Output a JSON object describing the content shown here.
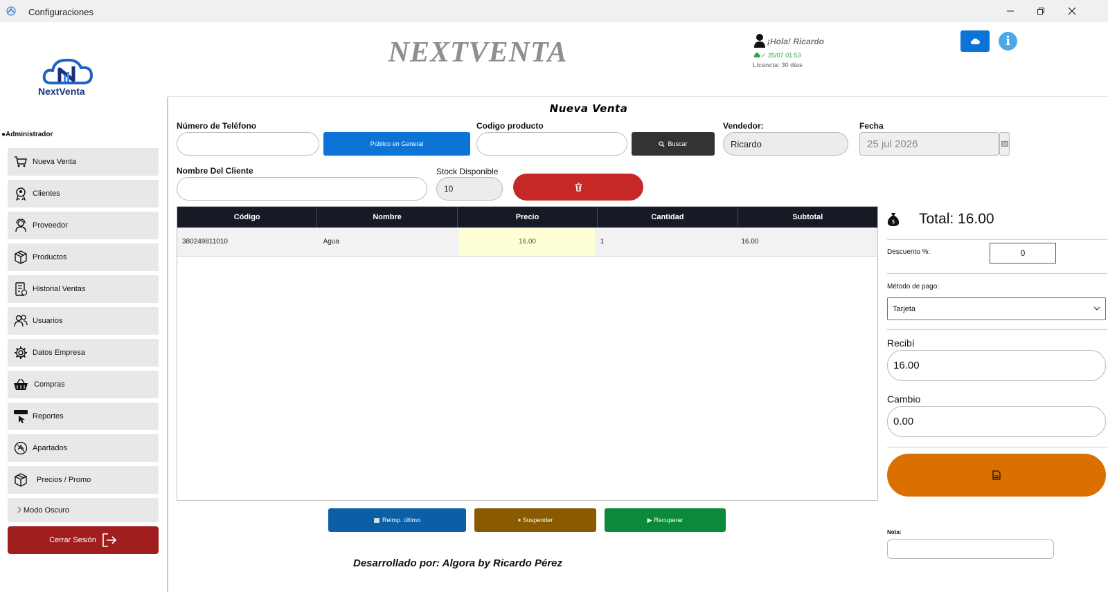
{
  "window": {
    "title": "Configuraciones"
  },
  "header": {
    "brand": "NEXTVENTA",
    "greeting": "¡Hola! Ricardo",
    "sync_status": "✓ 25/07 01:53",
    "license": "Licencia: 30 días",
    "logo_line": "NextVenta"
  },
  "sidebar": {
    "role": "●Administrador",
    "items": [
      {
        "label": "Nueva Venta",
        "icon": "cart-icon"
      },
      {
        "label": "Clientes",
        "icon": "client-badge-icon"
      },
      {
        "label": "Proveedor",
        "icon": "supplier-icon"
      },
      {
        "label": "Productos",
        "icon": "box-icon"
      },
      {
        "label": "Historial Ventas",
        "icon": "sales-history-icon"
      },
      {
        "label": "Usuarios",
        "icon": "users-icon"
      },
      {
        "label": "Datos Empresa",
        "icon": "gear-icon"
      },
      {
        "label": "Compras",
        "icon": "basket-icon"
      },
      {
        "label": "Reportes",
        "icon": "report-icon"
      },
      {
        "label": "Apartados",
        "icon": "layaway-icon"
      },
      {
        "label": "Precios / Promo",
        "icon": "price-box-icon"
      }
    ],
    "dark_mode": "☽ Modo Oscuro",
    "logout": "Cerrar Sesión"
  },
  "main": {
    "title": "Nueva Venta",
    "phone_label": "Número de Teléfono",
    "phone_value": "",
    "public_button": "Público en General",
    "product_code_label": "Codigo producto",
    "product_code_value": "",
    "search_button": "Buscar",
    "seller_label": "Vendedor:",
    "seller_value": "Ricardo",
    "date_label": "Fecha",
    "date_value": "25 jul 2026",
    "client_name_label": "Nombre Del Cliente",
    "client_name_value": "",
    "stock_label": "Stock Disponible",
    "stock_value": "10",
    "table": {
      "columns": [
        "Código",
        "Nombre",
        "Precio",
        "Cantidad",
        "Subtotal"
      ],
      "rows": [
        {
          "codigo": "380249811010",
          "nombre": "Agua",
          "precio": "16.00",
          "cantidad": "1",
          "subtotal": "16.00"
        }
      ]
    },
    "buttons": {
      "reprint": "Reimp. último",
      "suspend": "⏸ Suspender",
      "recover": "▶ Recuperar"
    },
    "footer": "Desarrollado por: Algora by Ricardo Pérez"
  },
  "panel": {
    "total": "Total: 16.00",
    "discount_label": "Descuento %:",
    "discount_value": "0",
    "payment_label": "Método de pago:",
    "payment_value": "Tarjeta",
    "received_label": "Recibí",
    "received_value": "16.00",
    "change_label": "Cambio",
    "change_value": "0.00",
    "note_label": "Nota:",
    "note_value": ""
  },
  "colors": {
    "primary_blue": "#0b74d6",
    "dark_button": "#333333",
    "delete_red": "#c62828",
    "logout_red": "#a01e1e",
    "reprint_blue": "#0b5fa5",
    "suspend_brown": "#8a5a00",
    "recover_green": "#0a8a3a",
    "charge_orange": "#d97000",
    "table_header": "#161a24"
  }
}
